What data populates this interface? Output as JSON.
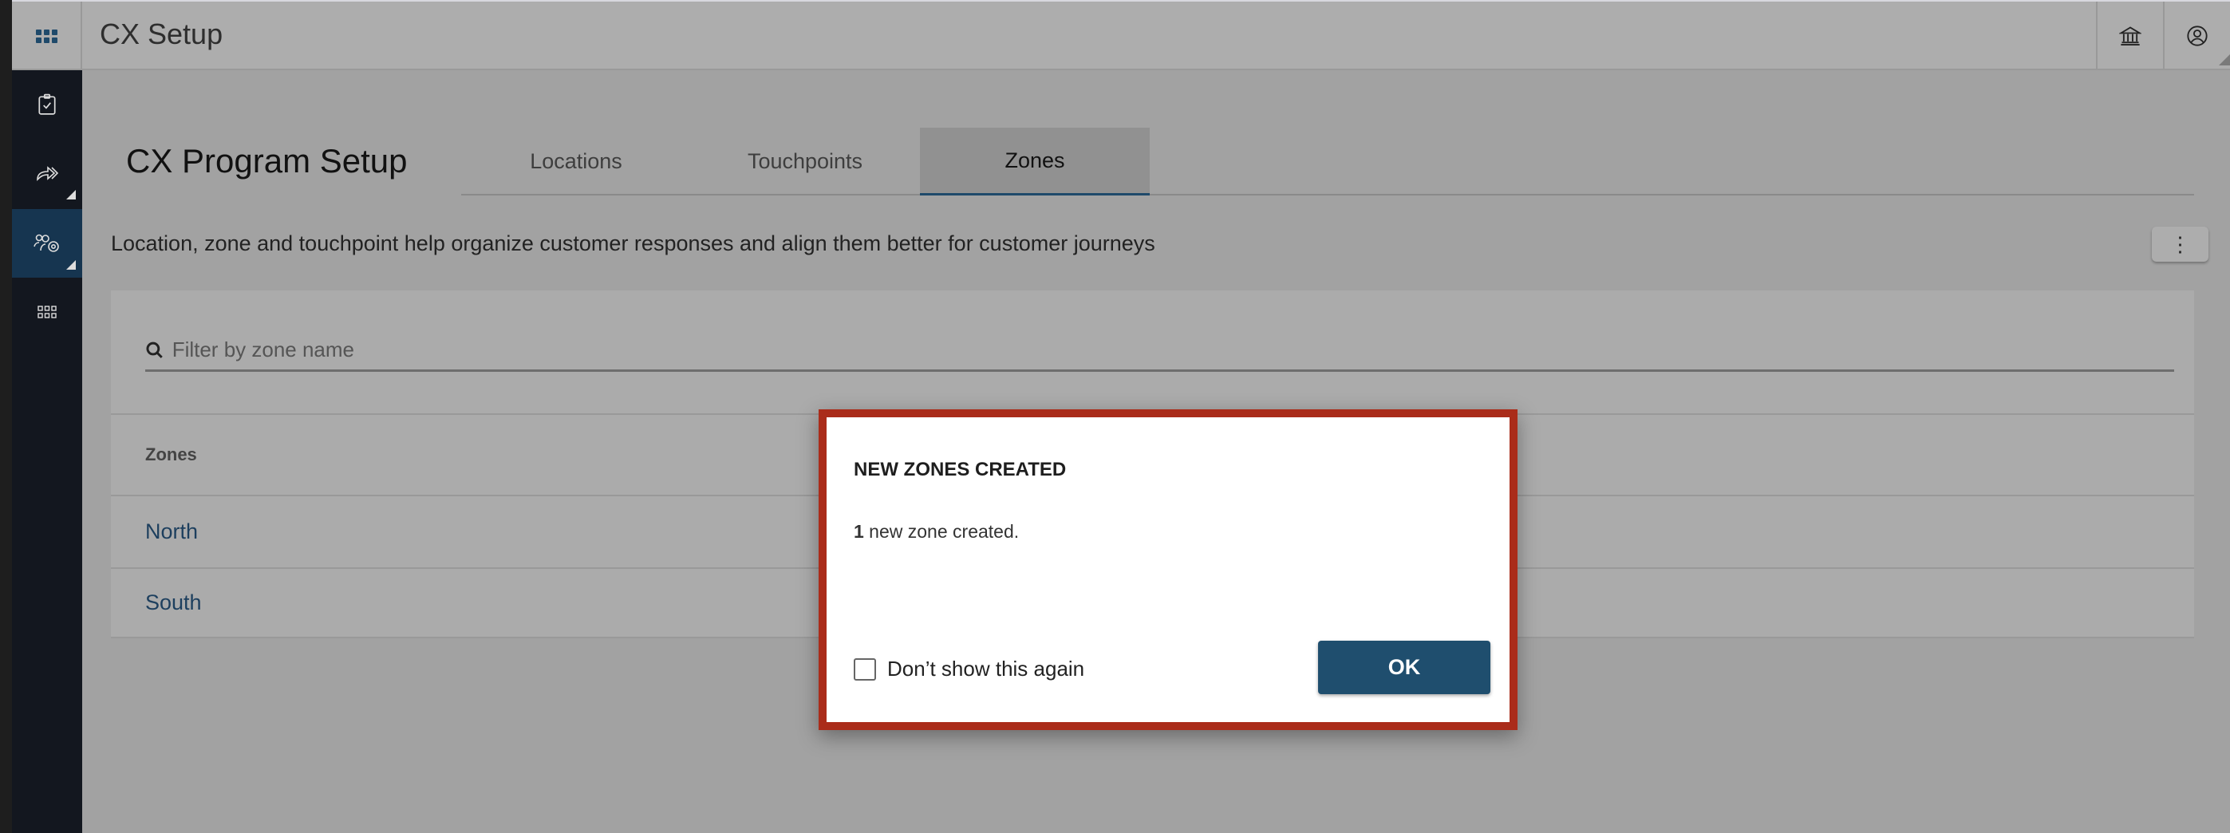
{
  "header": {
    "app_title": "CX Setup",
    "icons": [
      "apps-grid-icon",
      "institution-icon",
      "user-account-icon"
    ]
  },
  "sidebar": {
    "items": [
      {
        "icon": "clipboard-check-icon",
        "active": false
      },
      {
        "icon": "share-forward-icon",
        "active": false,
        "expandable": true
      },
      {
        "icon": "users-settings-icon",
        "active": true,
        "expandable": true
      },
      {
        "icon": "small-grid-icon",
        "active": false
      }
    ]
  },
  "page": {
    "title": "CX Program Setup",
    "tabs": [
      {
        "label": "Locations"
      },
      {
        "label": "Touchpoints"
      },
      {
        "label": "Zones",
        "active": true
      }
    ],
    "description": "Location, zone and touchpoint help organize customer responses and align them better for customer journeys",
    "more_icon": "⋮"
  },
  "filter": {
    "placeholder": "Filter by zone name",
    "value": ""
  },
  "table": {
    "column": "Zones",
    "rows": [
      "North",
      "South"
    ]
  },
  "dialog": {
    "title": "NEW ZONES CREATED",
    "count": "1",
    "message": " new zone created.",
    "checkbox_label": "Don’t show this again",
    "checked": false,
    "ok_label": "OK"
  },
  "colors": {
    "accent": "#1f4e6e",
    "dialog_border": "#aa2c1a",
    "sidebar": "#13171f",
    "sidebar_active": "#163550"
  }
}
